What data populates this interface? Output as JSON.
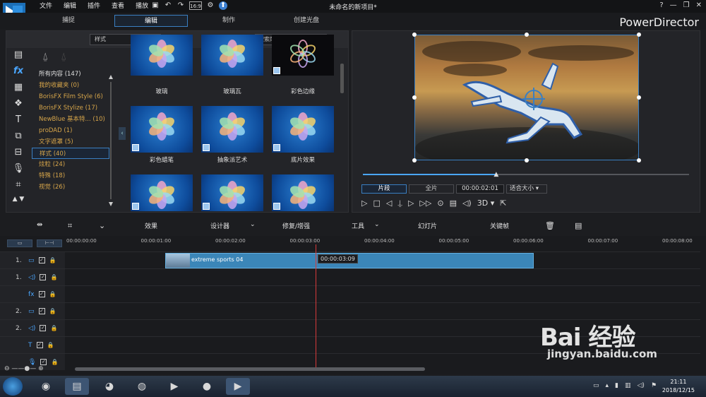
{
  "window": {
    "title": "未命名的新项目*",
    "brand": "PowerDirector",
    "menu": [
      "文件",
      "编辑",
      "插件",
      "查看",
      "播放"
    ],
    "controls": [
      "?",
      "—",
      "❐",
      "✕"
    ]
  },
  "modes": {
    "tabs": [
      "捕捉",
      "编辑",
      "制作",
      "创建光盘"
    ],
    "active": "编辑"
  },
  "library": {
    "filter_select": "样式",
    "search_placeholder": "搜索库",
    "categories": [
      {
        "label": "所有内容 (147)",
        "style": "white"
      },
      {
        "label": "我的收藏夹 (0)",
        "style": "gold"
      },
      {
        "label": "BorisFX Film Style  (6)",
        "style": "gold"
      },
      {
        "label": "BorisFX Stylize  (17)",
        "style": "gold"
      },
      {
        "label": "NewBlue 基本特... (10)",
        "style": "gold"
      },
      {
        "label": "proDAD  (1)",
        "style": "gold"
      },
      {
        "label": "文字遮罩  (5)",
        "style": "gold"
      },
      {
        "label": "样式 (40)",
        "style": "selected"
      },
      {
        "label": "炫粒  (24)",
        "style": "gold"
      },
      {
        "label": "特殊  (18)",
        "style": "gold"
      },
      {
        "label": "视觉  (26)",
        "style": "gold"
      }
    ],
    "effects": [
      "玻璃",
      "玻璃瓦",
      "彩色边缘",
      "彩色蜡笔",
      "抽象派艺术",
      "底片效果"
    ]
  },
  "preview": {
    "mode_clip": "片段",
    "mode_full": "全片",
    "timecode": "00:00:02:01",
    "fit": "适合大小",
    "playback_position": 0.41,
    "three_d": "3D"
  },
  "toolbar": {
    "effects": "效果",
    "designer": "设计器",
    "fix_enhance": "修复/增强",
    "tools": "工具",
    "slideshow": "幻灯片",
    "keyframe": "关键帧"
  },
  "timeline": {
    "ruler": [
      "00:00:00:00",
      "00:00:01:00",
      "00:00:02:00",
      "00:00:03:00",
      "00:00:04:00",
      "00:00:05:00",
      "00:00:06:00",
      "00:00:07:00",
      "00:00:08:00"
    ],
    "tracks": [
      {
        "id": "1.",
        "icon": "video-track-icon"
      },
      {
        "id": "1.",
        "icon": "audio-track-icon"
      },
      {
        "id": "",
        "icon": "fx-track-icon"
      },
      {
        "id": "2.",
        "icon": "video-track-icon"
      },
      {
        "id": "2.",
        "icon": "audio-track-icon"
      },
      {
        "id": "",
        "icon": "title-track-icon"
      },
      {
        "id": "",
        "icon": "voice-track-icon"
      }
    ],
    "clip_name": "extreme sports 04",
    "playhead_tooltip": "00:00:03:09"
  },
  "taskbar": {
    "time": "21:11",
    "date": "2018/12/15"
  },
  "watermark": {
    "logo_text": "Bai 经验",
    "url": "jingyan.baidu.com"
  }
}
